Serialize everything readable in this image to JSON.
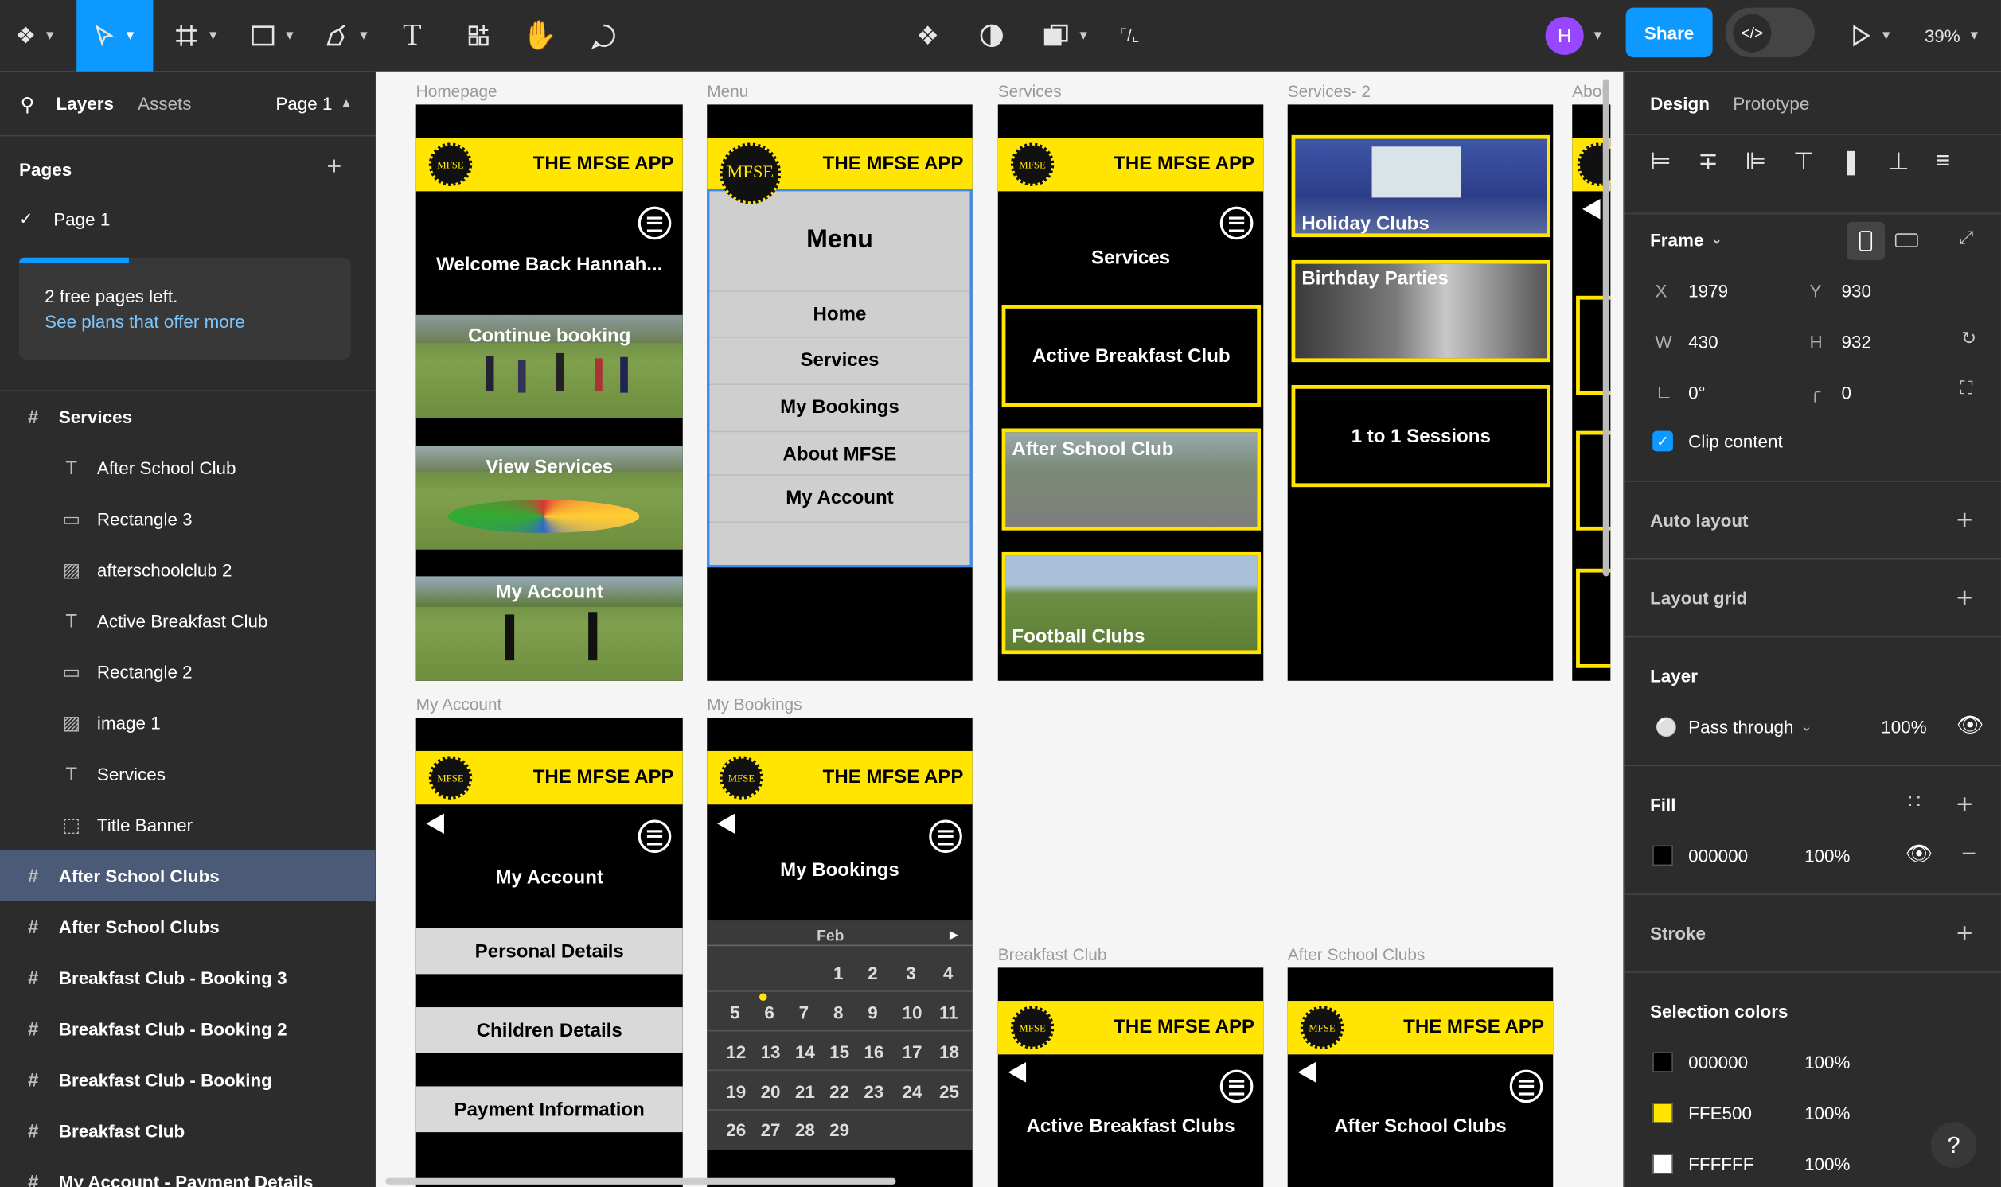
{
  "toolbar": {
    "share": "Share",
    "zoom": "39%",
    "avatar": "H"
  },
  "left": {
    "tabs": {
      "layers": "Layers",
      "assets": "Assets",
      "page_selector": "Page 1"
    },
    "pages_heading": "Pages",
    "page1": "Page 1",
    "notice": {
      "line1": "2 free pages left.",
      "link": "See plans that offer more"
    },
    "layers": [
      {
        "label": "Services",
        "kind": "frame"
      },
      {
        "label": "After School Club",
        "kind": "text"
      },
      {
        "label": "Rectangle 3",
        "kind": "rect"
      },
      {
        "label": "afterschoolclub 2",
        "kind": "image"
      },
      {
        "label": "Active Breakfast Club",
        "kind": "text"
      },
      {
        "label": "Rectangle 2",
        "kind": "rect"
      },
      {
        "label": "image 1",
        "kind": "image"
      },
      {
        "label": "Services",
        "kind": "text"
      },
      {
        "label": "Title Banner",
        "kind": "group"
      },
      {
        "label": "After School Clubs",
        "kind": "frame"
      },
      {
        "label": "After School Clubs",
        "kind": "frame"
      },
      {
        "label": "Breakfast Club - Booking 3",
        "kind": "frame"
      },
      {
        "label": "Breakfast Club - Booking 2",
        "kind": "frame"
      },
      {
        "label": "Breakfast Club - Booking",
        "kind": "frame"
      },
      {
        "label": "Breakfast Club",
        "kind": "frame"
      },
      {
        "label": "My Account - Payment Details",
        "kind": "frame"
      }
    ]
  },
  "right": {
    "tabs": {
      "design": "Design",
      "prototype": "Prototype"
    },
    "frame": {
      "heading": "Frame",
      "x_label": "X",
      "x": "1979",
      "y_label": "Y",
      "y": "930",
      "w_label": "W",
      "w": "430",
      "h_label": "H",
      "h": "932",
      "rotation": "0°",
      "radius": "0",
      "clip": "Clip content"
    },
    "auto_layout": "Auto layout",
    "layout_grid": "Layout grid",
    "layer": {
      "heading": "Layer",
      "blend": "Pass through",
      "opacity": "100%"
    },
    "fill": {
      "heading": "Fill",
      "hex": "000000",
      "opacity": "100%"
    },
    "stroke": "Stroke",
    "selection_colors": {
      "heading": "Selection colors",
      "items": [
        {
          "hex": "000000",
          "opacity": "100%",
          "color": "#000000"
        },
        {
          "hex": "FFE500",
          "opacity": "100%",
          "color": "#FFE500"
        },
        {
          "hex": "FFFFFF",
          "opacity": "100%",
          "color": "#FFFFFF"
        }
      ]
    },
    "help": "?"
  },
  "canvas": {
    "app_title": "THE MFSE APP",
    "logo": "MFSE",
    "homepage": {
      "label": "Homepage",
      "welcome": "Welcome Back Hannah...",
      "tiles": [
        "Continue booking",
        "View Services",
        "My Account"
      ]
    },
    "menu": {
      "label": "Menu",
      "heading": "Menu",
      "items": [
        "Home",
        "Services",
        "My Bookings",
        "About MFSE",
        "My Account"
      ]
    },
    "services": {
      "label": "Services",
      "heading": "Services",
      "items": [
        "Active Breakfast Club",
        "After School Club",
        "Football Clubs"
      ]
    },
    "services2": {
      "label": "Services- 2",
      "items": [
        "Holiday Clubs",
        "Birthday Parties",
        "1 to 1 Sessions"
      ]
    },
    "about": {
      "label": "About"
    },
    "my_account": {
      "label": "My Account",
      "heading": "My Account",
      "items": [
        "Personal Details",
        "Children Details",
        "Payment Information"
      ]
    },
    "my_bookings": {
      "label": "My Bookings",
      "heading": "My Bookings",
      "month": "Feb",
      "rows": [
        [
          "",
          "",
          "",
          "",
          "1",
          "2",
          "3",
          "4"
        ],
        [
          "",
          "5",
          "6",
          "7",
          "8",
          "9",
          "10",
          "11"
        ],
        [
          "",
          "12",
          "13",
          "14",
          "15",
          "16",
          "17",
          "18"
        ],
        [
          "",
          "19",
          "20",
          "21",
          "22",
          "23",
          "24",
          "25"
        ],
        [
          "",
          "26",
          "27",
          "28",
          "29",
          "",
          "",
          ""
        ]
      ]
    },
    "breakfast": {
      "label": "Breakfast Club",
      "heading": "Active Breakfast Clubs"
    },
    "afterschool": {
      "label": "After School Clubs",
      "heading": "After School Clubs"
    }
  }
}
